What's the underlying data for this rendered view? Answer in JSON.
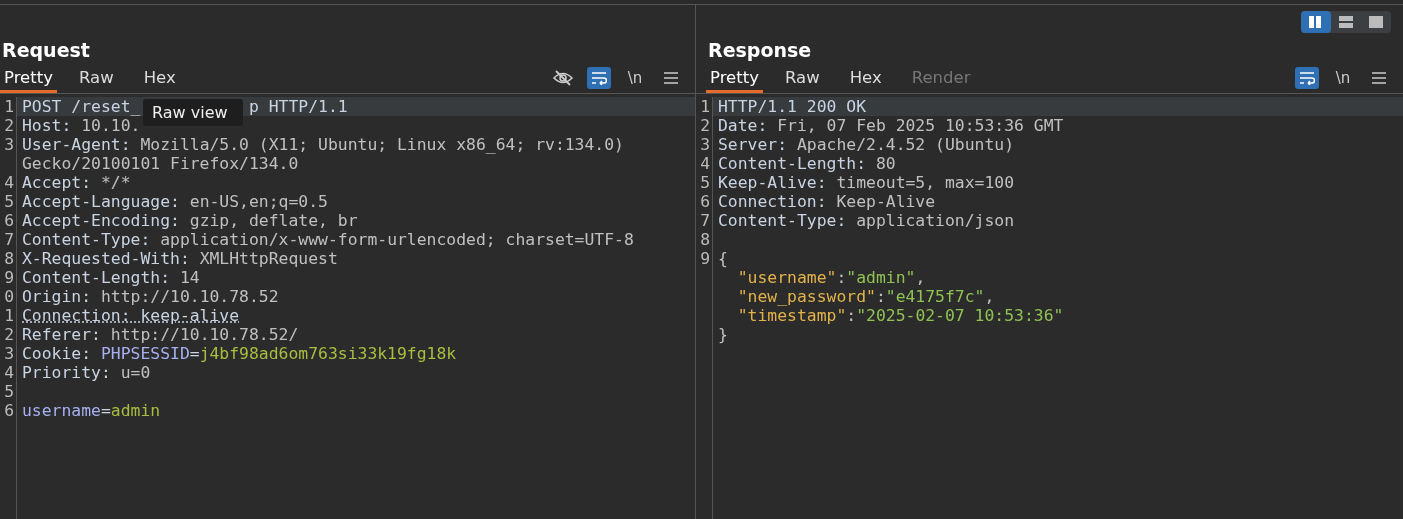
{
  "layout_buttons": [
    {
      "kind": "columns",
      "selected": true
    },
    {
      "kind": "rows",
      "selected": false
    },
    {
      "kind": "single",
      "selected": false
    }
  ],
  "panes": [
    {
      "title": "Request",
      "tabs": [
        {
          "label": "Pretty",
          "selected": true,
          "disabled": false
        },
        {
          "label": "Raw",
          "selected": false,
          "disabled": false
        },
        {
          "label": "Hex",
          "selected": false,
          "disabled": false
        }
      ],
      "tools": [
        {
          "kind": "hide",
          "selected": false
        },
        {
          "kind": "wrap",
          "selected": true
        },
        {
          "kind": "newline",
          "label": "\\n",
          "selected": false
        },
        {
          "kind": "menu",
          "selected": false
        }
      ],
      "tooltip": "Raw view",
      "lines": [
        {
          "number": "1",
          "highlight": true,
          "rows": [
            [
              {
                "kind": "name",
                "text": "POST /reset_"
              },
              {
                "kind": "gap"
              },
              {
                "kind": "name",
                "text": "p HTTP/1.1"
              }
            ]
          ]
        },
        {
          "number": "2",
          "highlight": false,
          "rows": [
            [
              {
                "kind": "name",
                "text": "Host:"
              },
              {
                "kind": "value",
                "text": " 10.10."
              }
            ]
          ]
        },
        {
          "number": "3",
          "highlight": false,
          "rows": [
            [
              {
                "kind": "name",
                "text": "User-Agent:"
              },
              {
                "kind": "value",
                "text": " Mozilla/5.0 (X11; Ubuntu; Linux x86_64; rv:134.0)"
              }
            ],
            [
              {
                "kind": "value",
                "text": "Gecko/20100101 Firefox/134.0"
              }
            ]
          ]
        },
        {
          "number": "4",
          "highlight": false,
          "rows": [
            [
              {
                "kind": "name",
                "text": "Accept:"
              },
              {
                "kind": "value",
                "text": " */*"
              }
            ]
          ]
        },
        {
          "number": "5",
          "highlight": false,
          "rows": [
            [
              {
                "kind": "name",
                "text": "Accept-Language:"
              },
              {
                "kind": "value",
                "text": " en-US,en;q=0.5"
              }
            ]
          ]
        },
        {
          "number": "6",
          "highlight": false,
          "rows": [
            [
              {
                "kind": "name",
                "text": "Accept-Encoding:"
              },
              {
                "kind": "value",
                "text": " gzip, deflate, br"
              }
            ]
          ]
        },
        {
          "number": "7",
          "highlight": false,
          "rows": [
            [
              {
                "kind": "name",
                "text": "Content-Type:"
              },
              {
                "kind": "value",
                "text": " application/x-www-form-urlencoded; charset=UTF-8"
              }
            ]
          ]
        },
        {
          "number": "8",
          "highlight": false,
          "rows": [
            [
              {
                "kind": "name",
                "text": "X-Requested-With:"
              },
              {
                "kind": "value",
                "text": " XMLHttpRequest"
              }
            ]
          ]
        },
        {
          "number": "9",
          "highlight": false,
          "rows": [
            [
              {
                "kind": "name",
                "text": "Content-Length:"
              },
              {
                "kind": "value",
                "text": " 14"
              }
            ]
          ]
        },
        {
          "number": "0",
          "highlight": false,
          "rows": [
            [
              {
                "kind": "name",
                "text": "Origin:"
              },
              {
                "kind": "value",
                "text": " http://10.10.78.52"
              }
            ]
          ]
        },
        {
          "number": "1",
          "highlight": false,
          "rows": [
            [
              {
                "kind": "underlined",
                "text": "Connection: keep-alive"
              }
            ]
          ]
        },
        {
          "number": "2",
          "highlight": false,
          "rows": [
            [
              {
                "kind": "name",
                "text": "Referer:"
              },
              {
                "kind": "value",
                "text": " http://10.10.78.52/"
              }
            ]
          ]
        },
        {
          "number": "3",
          "highlight": false,
          "rows": [
            [
              {
                "kind": "name",
                "text": "Cookie:"
              },
              {
                "kind": "space"
              },
              {
                "kind": "param",
                "text": "PHPSESSID"
              },
              {
                "kind": "name",
                "text": "="
              },
              {
                "kind": "pvalue",
                "text": "j4bf98ad6om763si33k19fg18k"
              }
            ]
          ]
        },
        {
          "number": "4",
          "highlight": false,
          "rows": [
            [
              {
                "kind": "name",
                "text": "Priority:"
              },
              {
                "kind": "value",
                "text": " u=0"
              }
            ]
          ]
        },
        {
          "number": "5",
          "highlight": false,
          "rows": [
            []
          ]
        },
        {
          "number": "6",
          "highlight": false,
          "rows": [
            [
              {
                "kind": "param",
                "text": "username"
              },
              {
                "kind": "name",
                "text": "="
              },
              {
                "kind": "pvalue",
                "text": "admin"
              }
            ]
          ]
        }
      ]
    },
    {
      "title": "Response",
      "tabs": [
        {
          "label": "Pretty",
          "selected": true,
          "disabled": false
        },
        {
          "label": "Raw",
          "selected": false,
          "disabled": false
        },
        {
          "label": "Hex",
          "selected": false,
          "disabled": false
        },
        {
          "label": "Render",
          "selected": false,
          "disabled": true
        }
      ],
      "tools": [
        {
          "kind": "wrap",
          "selected": true
        },
        {
          "kind": "newline",
          "label": "\\n",
          "selected": false
        },
        {
          "kind": "menu",
          "selected": false
        }
      ],
      "lines": [
        {
          "number": "1",
          "highlight": true,
          "rows": [
            [
              {
                "kind": "name",
                "text": "HTTP/1.1 200 OK"
              }
            ]
          ]
        },
        {
          "number": "2",
          "highlight": false,
          "rows": [
            [
              {
                "kind": "name",
                "text": "Date:"
              },
              {
                "kind": "value",
                "text": " Fri, 07 Feb 2025 10:53:36 GMT"
              }
            ]
          ]
        },
        {
          "number": "3",
          "highlight": false,
          "rows": [
            [
              {
                "kind": "name",
                "text": "Server:"
              },
              {
                "kind": "value",
                "text": " Apache/2.4.52 (Ubuntu)"
              }
            ]
          ]
        },
        {
          "number": "4",
          "highlight": false,
          "rows": [
            [
              {
                "kind": "name",
                "text": "Content-Length:"
              },
              {
                "kind": "value",
                "text": " 80"
              }
            ]
          ]
        },
        {
          "number": "5",
          "highlight": false,
          "rows": [
            [
              {
                "kind": "name",
                "text": "Keep-Alive:"
              },
              {
                "kind": "value",
                "text": " timeout=5, max=100"
              }
            ]
          ]
        },
        {
          "number": "6",
          "highlight": false,
          "rows": [
            [
              {
                "kind": "name",
                "text": "Connection:"
              },
              {
                "kind": "value",
                "text": " Keep-Alive"
              }
            ]
          ]
        },
        {
          "number": "7",
          "highlight": false,
          "rows": [
            [
              {
                "kind": "name",
                "text": "Content-Type:"
              },
              {
                "kind": "value",
                "text": " application/json"
              }
            ]
          ]
        },
        {
          "number": "8",
          "highlight": false,
          "rows": [
            []
          ]
        },
        {
          "number": "9",
          "highlight": false,
          "rows": [
            [
              {
                "kind": "value",
                "text": "{"
              }
            ],
            {
              "key": "\"username\"",
              "sep": ":",
              "value": "\"admin\"",
              "end": ","
            },
            {
              "key": "\"new_password\"",
              "sep": ":",
              "value": "\"e4175f7c\"",
              "end": ","
            },
            {
              "key": "\"timestamp\"",
              "sep": ":",
              "value": "\"2025-02-07 10:53:36\""
            },
            [
              {
                "kind": "value",
                "text": "}"
              }
            ]
          ]
        }
      ]
    }
  ]
}
